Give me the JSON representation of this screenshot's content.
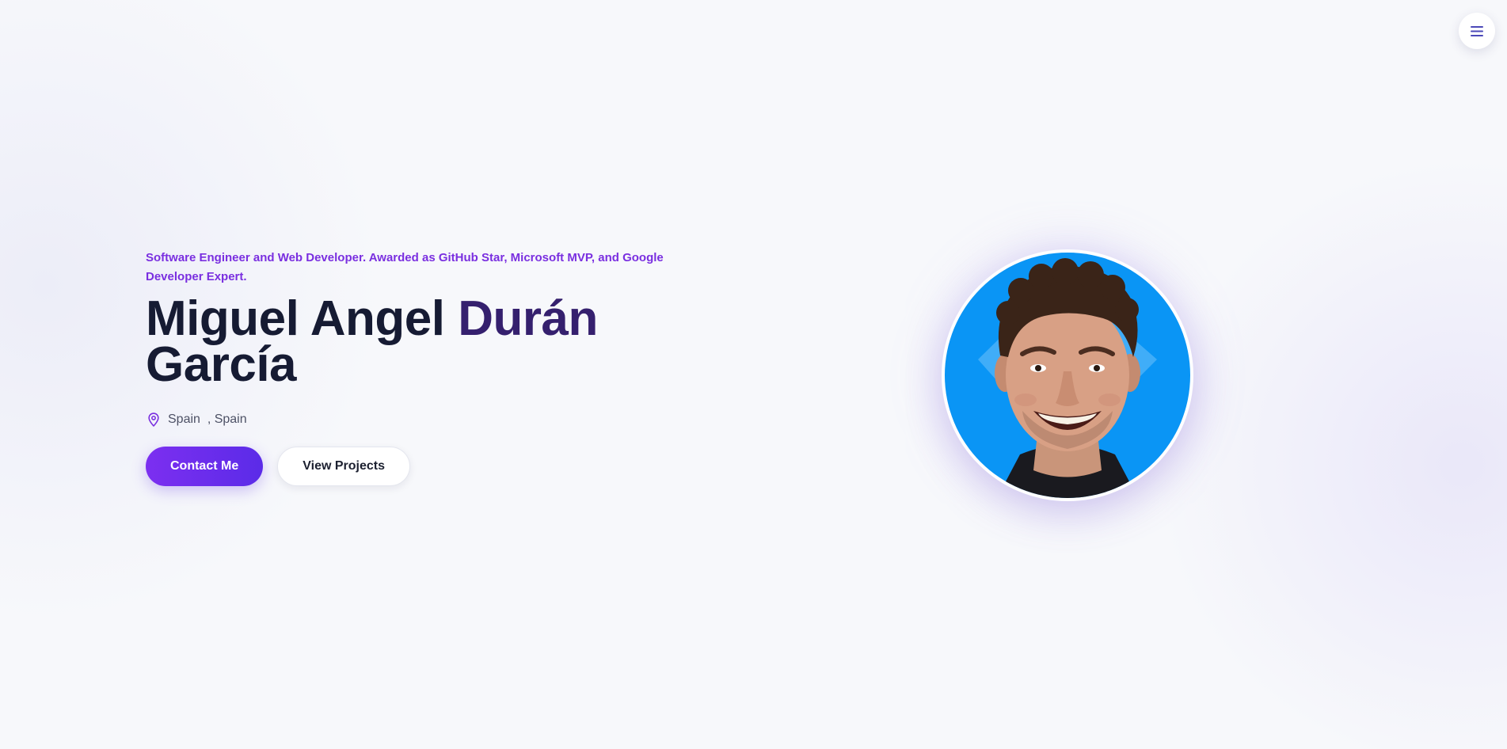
{
  "header": {
    "menu_icon": "hamburger-menu-icon"
  },
  "hero": {
    "tagline": "Software Engineer and Web Developer. Awarded as GitHub Star, Microsoft MVP, and Google Developer Expert.",
    "name_first": "Miguel Angel ",
    "name_accent": "Durán",
    "name_last": "García",
    "location": "Spain  , Spain",
    "location_icon": "map-pin-icon",
    "contact_label": "Contact Me",
    "projects_label": "View Projects"
  },
  "profile": {
    "avatar_icon": "profile-photo"
  },
  "colors": {
    "accent": "#7a2fe0",
    "primary_button": "#6a2ff0",
    "heading": "#161b33",
    "avatar_background": "#0a95f5"
  }
}
